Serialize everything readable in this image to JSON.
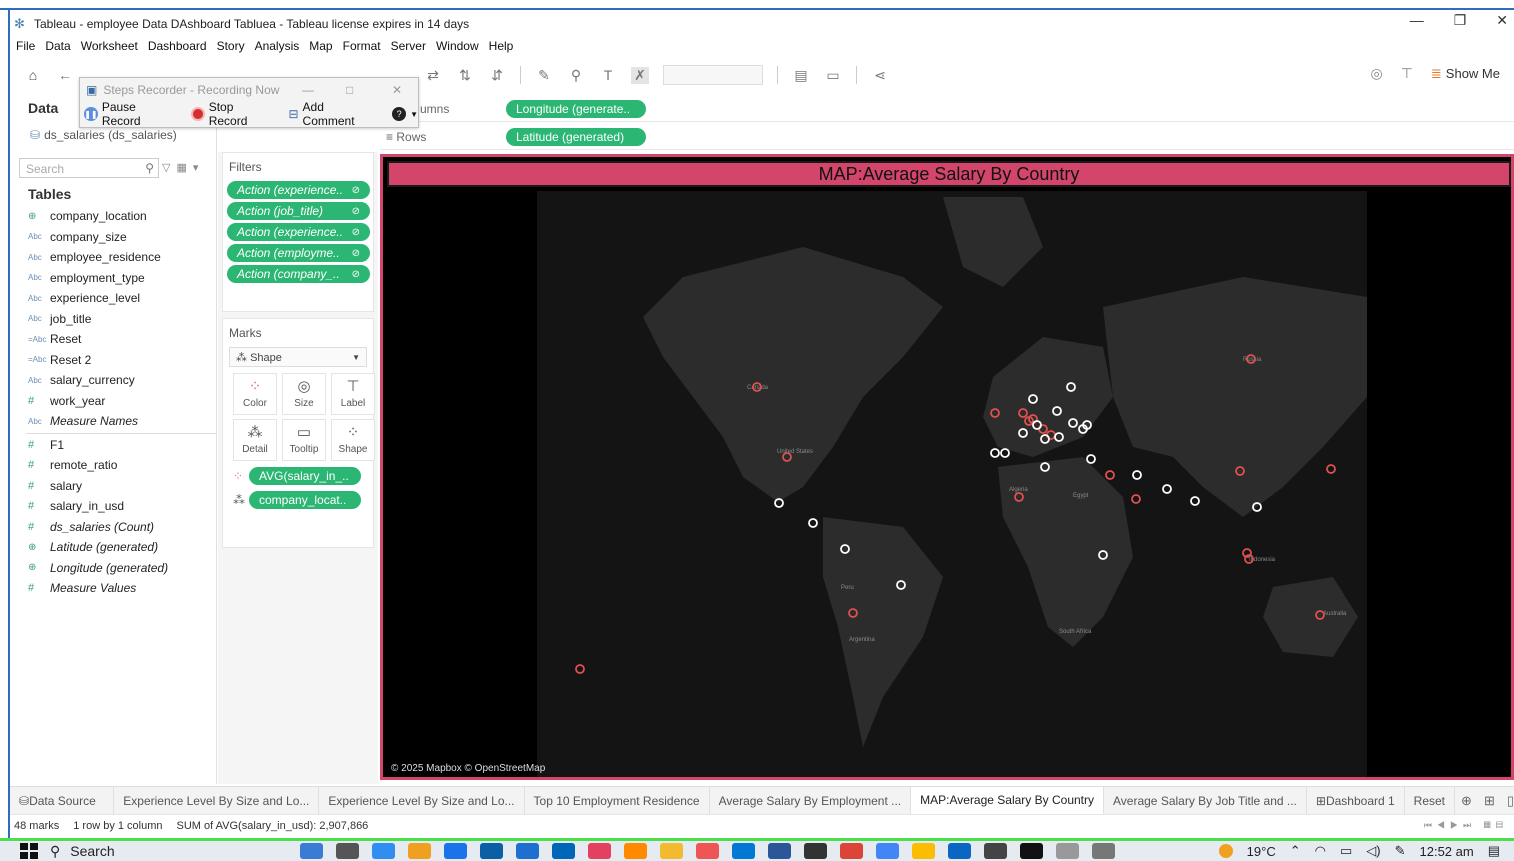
{
  "window": {
    "title": "Tableau - employee Data DAshboard Tabluea - Tableau license expires in 14 days",
    "controls": [
      "—",
      "❐",
      "✕"
    ]
  },
  "menu": [
    "File",
    "Data",
    "Worksheet",
    "Dashboard",
    "Story",
    "Analysis",
    "Map",
    "Format",
    "Server",
    "Window",
    "Help"
  ],
  "toolbar": {
    "show_me": "Show Me"
  },
  "steps_recorder": {
    "title": "Steps Recorder - Recording Now",
    "pause": "Pause Record",
    "stop": "Stop Record",
    "comment": "Add Comment"
  },
  "data_pane": {
    "header": "Data",
    "datasource": "ds_salaries (ds_salaries)",
    "search_placeholder": "Search",
    "tables_header": "Tables",
    "fields": [
      {
        "name": "company_location",
        "type": "geo"
      },
      {
        "name": "company_size",
        "type": "Abc"
      },
      {
        "name": "employee_residence",
        "type": "Abc"
      },
      {
        "name": "employment_type",
        "type": "Abc"
      },
      {
        "name": "experience_level",
        "type": "Abc"
      },
      {
        "name": "job_title",
        "type": "Abc"
      },
      {
        "name": "Reset",
        "type": "=Abc"
      },
      {
        "name": "Reset 2",
        "type": "=Abc"
      },
      {
        "name": "salary_currency",
        "type": "Abc"
      },
      {
        "name": "work_year",
        "type": "#"
      },
      {
        "name": "Measure Names",
        "type": "Abc",
        "italic": true
      },
      {
        "name": "F1",
        "type": "#"
      },
      {
        "name": "remote_ratio",
        "type": "#"
      },
      {
        "name": "salary",
        "type": "#"
      },
      {
        "name": "salary_in_usd",
        "type": "#"
      },
      {
        "name": "ds_salaries (Count)",
        "type": "=#",
        "italic": true
      },
      {
        "name": "Latitude (generated)",
        "type": "geo",
        "italic": true
      },
      {
        "name": "Longitude (generated)",
        "type": "geo",
        "italic": true
      },
      {
        "name": "Measure Values",
        "type": "#",
        "italic": true
      }
    ]
  },
  "filters": {
    "header": "Filters",
    "items": [
      "Action (experience..",
      "Action (job_title)",
      "Action (experience..",
      "Action (employme..",
      "Action (company_.."
    ]
  },
  "marks": {
    "header": "Marks",
    "type": "Shape",
    "buttons": [
      "Color",
      "Size",
      "Label",
      "Detail",
      "Tooltip",
      "Shape"
    ],
    "pills": [
      "AVG(salary_in_..",
      "company_locat.."
    ]
  },
  "shelves": {
    "columns_label": "umns",
    "columns_pill": "Longitude (generate..",
    "rows_label": "Rows",
    "rows_pill": "Latitude (generated)"
  },
  "viz": {
    "title": "MAP:Average Salary By Country",
    "credit": "© 2025 Mapbox © OpenStreetMap",
    "map_labels": [
      "Canada",
      "United States",
      "Algeria",
      "Egypt",
      "Russia",
      "Indonesia",
      "Peru",
      "Argentina",
      "South Africa",
      "Australia"
    ]
  },
  "tabs": [
    {
      "label": "Data Source",
      "icon": "⛁"
    },
    {
      "label": "Experience Level By Size and Lo..."
    },
    {
      "label": "Experience Level By Size and Lo..."
    },
    {
      "label": "Top 10 Employment  Residence"
    },
    {
      "label": "Average Salary By Employment ..."
    },
    {
      "label": "MAP:Average Salary By Country",
      "active": true
    },
    {
      "label": "Average Salary By Job Title and ..."
    },
    {
      "label": "Dashboard 1",
      "icon": "⊞"
    },
    {
      "label": "Reset"
    }
  ],
  "status": {
    "marks": "48 marks",
    "rows": "1 row by 1 column",
    "sum": "SUM of AVG(salary_in_usd): 2,907,866"
  },
  "taskbar": {
    "search": "Search",
    "weather": "19°C",
    "time": "12:52 am"
  },
  "colors": {
    "accent": "#d4456b",
    "pill": "#2bb673",
    "mark_red": "#e05050",
    "mark_white": "#ffffff"
  }
}
